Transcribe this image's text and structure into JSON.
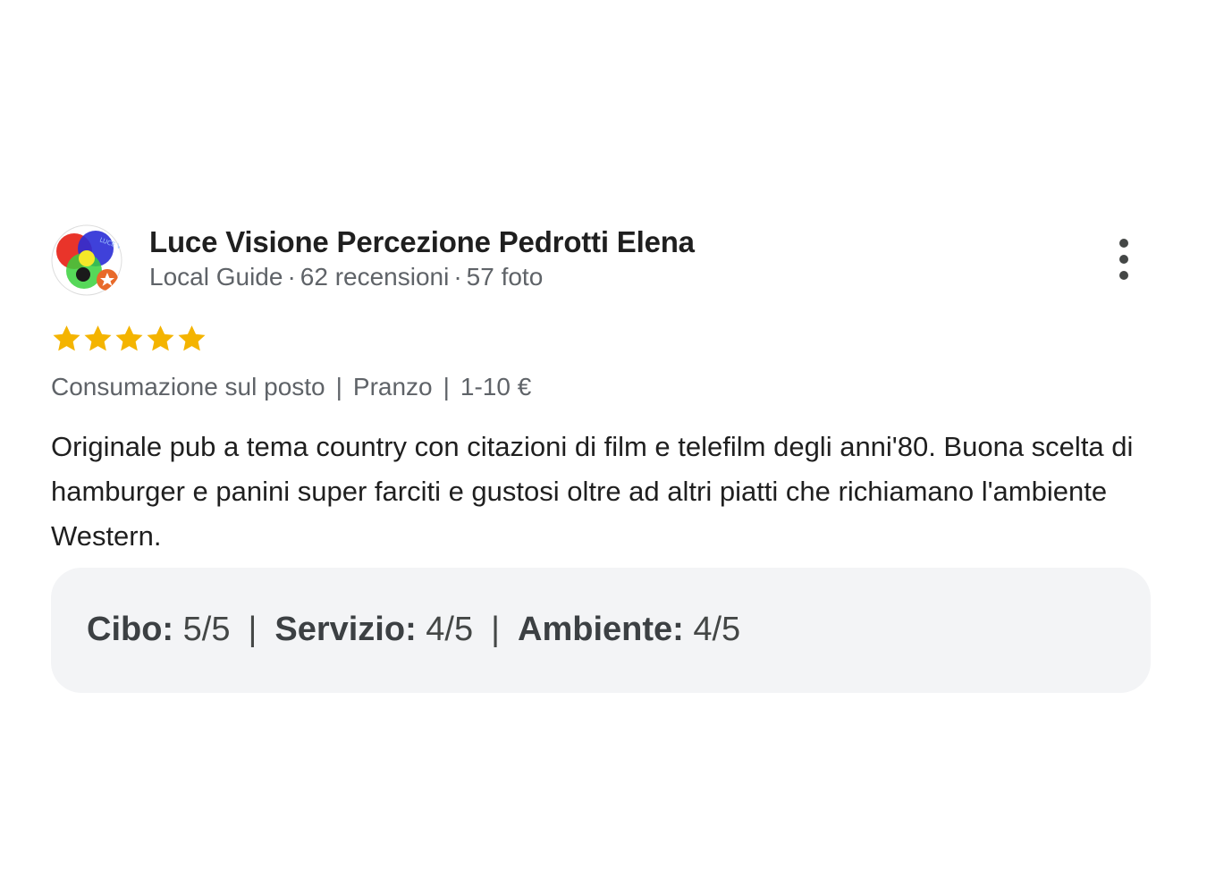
{
  "reviewer": {
    "name": "Luce Visione Percezione Pedrotti Elena",
    "badge": "Local Guide",
    "separator": "·",
    "reviews_count": "62 recensioni",
    "photos_count": "57 foto",
    "avatar_text": "LUCE VISIONE"
  },
  "rating": {
    "stars": 5,
    "max": 5,
    "star_color": "#f4b400"
  },
  "tags": {
    "dining": "Consumazione sul posto",
    "meal": "Pranzo",
    "price": "1-10 €",
    "separator": "|"
  },
  "review_text": "Originale pub a tema country con citazioni di film e telefilm degli anni'80. Buona scelta di hamburger e panini super farciti e gustosi oltre ad altri piatti che richiamano l'ambiente Western.",
  "sub_ratings": {
    "food_label": "Cibo:",
    "food_value": "5/5",
    "service_label": "Servizio:",
    "service_value": "4/5",
    "ambience_label": "Ambiente:",
    "ambience_value": "4/5",
    "separator": "|"
  },
  "icons": {
    "menu": "more-vertical-icon",
    "star": "star-icon"
  }
}
